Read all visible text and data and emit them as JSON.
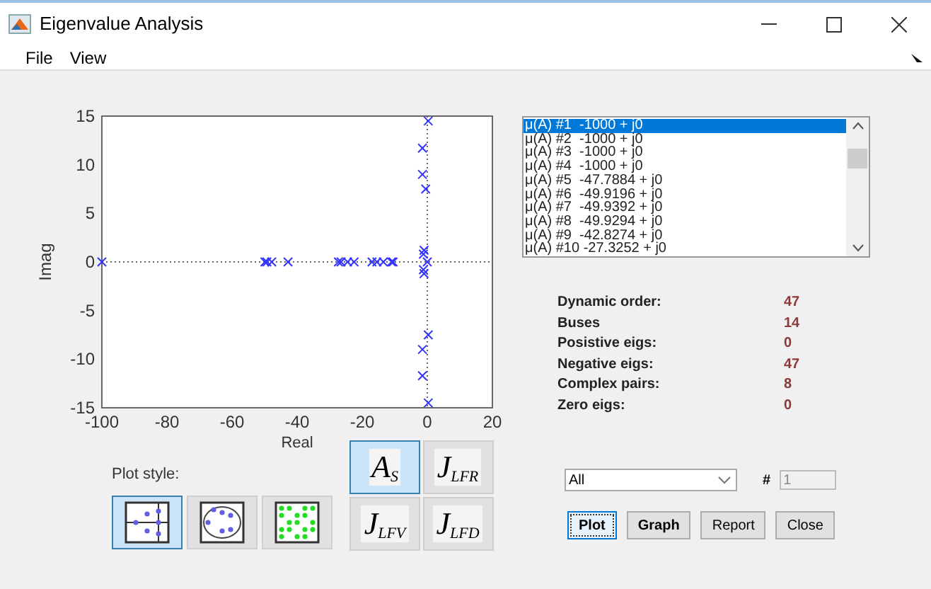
{
  "window": {
    "title": "Eigenvalue Analysis"
  },
  "menu": [
    {
      "label": "File"
    },
    {
      "label": "View"
    }
  ],
  "plot": {
    "chart_data": {
      "type": "scatter",
      "xlabel": "Real",
      "ylabel": "Imag",
      "xlim": [
        -100,
        20
      ],
      "ylim": [
        -15,
        15
      ],
      "xticks": [
        -100,
        -80,
        -60,
        -40,
        -20,
        0,
        20
      ],
      "yticks": [
        -15,
        -10,
        -5,
        0,
        5,
        10,
        15
      ],
      "x": [
        -100,
        -49.9,
        -49.3,
        -47.8,
        -42.8,
        -27.3,
        -26.5,
        -24.5,
        -22.5,
        -17,
        -15.5,
        -13.5,
        -11,
        -10.5,
        -1.5,
        -1.5,
        -1.5,
        -1.5,
        0.3,
        0.3,
        -0.5,
        0,
        -1,
        -1,
        -1.2,
        -1.2,
        0.3
      ],
      "series": [
        {
          "color": "#3333ff",
          "values": [
            0,
            0,
            0,
            0,
            0,
            0,
            0,
            0,
            0,
            0,
            0,
            0,
            0,
            0,
            11.7,
            9,
            -9,
            -11.7,
            14.5,
            -14.5,
            7.5,
            0,
            1.2,
            -1.2,
            0.8,
            -0.8,
            -7.5
          ]
        }
      ]
    }
  },
  "eigen_list": [
    {
      "label": "μ(A) #1  -1000 + j0",
      "selected": true
    },
    {
      "label": "μ(A) #2  -1000 + j0",
      "selected": false
    },
    {
      "label": "μ(A) #3  -1000 + j0",
      "selected": false
    },
    {
      "label": "μ(A) #4  -1000 + j0",
      "selected": false
    },
    {
      "label": "μ(A) #5  -47.7884 + j0",
      "selected": false
    },
    {
      "label": "μ(A) #6  -49.9196 + j0",
      "selected": false
    },
    {
      "label": "μ(A) #7  -49.9392 + j0",
      "selected": false
    },
    {
      "label": "μ(A) #8  -49.9294 + j0",
      "selected": false
    },
    {
      "label": "μ(A) #9  -42.8274 + j0",
      "selected": false
    },
    {
      "label": "μ(A) #10 -27.3252 + j0",
      "selected": false
    }
  ],
  "stats": [
    {
      "label": "Dynamic order:",
      "value": "47"
    },
    {
      "label": "Buses",
      "value": "14"
    },
    {
      "label": "Posistive eigs:",
      "value": "0"
    },
    {
      "label": "Negative eigs:",
      "value": "47"
    },
    {
      "label": "Complex pairs:",
      "value": "8"
    },
    {
      "label": "Zero eigs:",
      "value": "0"
    }
  ],
  "plot_style": {
    "label": "Plot style:",
    "options": [
      {
        "kind": "axes",
        "selected": true
      },
      {
        "kind": "circle",
        "selected": false
      },
      {
        "kind": "grid",
        "selected": false
      }
    ]
  },
  "matrices": [
    {
      "label": "A$_{S}$",
      "selected": true
    },
    {
      "label": "J$_{LFR}$",
      "selected": false
    },
    {
      "label": "J$_{LFV}$",
      "selected": false
    },
    {
      "label": "J$_{LFD}$",
      "selected": false
    }
  ],
  "filter": {
    "value": "All"
  },
  "index": {
    "label": "#",
    "value": "1",
    "disabled": true
  },
  "buttons": [
    {
      "label": "Plot",
      "selected": true
    },
    {
      "label": "Graph",
      "selected": false
    },
    {
      "label": "Report",
      "selected": false
    },
    {
      "label": "Close",
      "selected": false
    }
  ]
}
